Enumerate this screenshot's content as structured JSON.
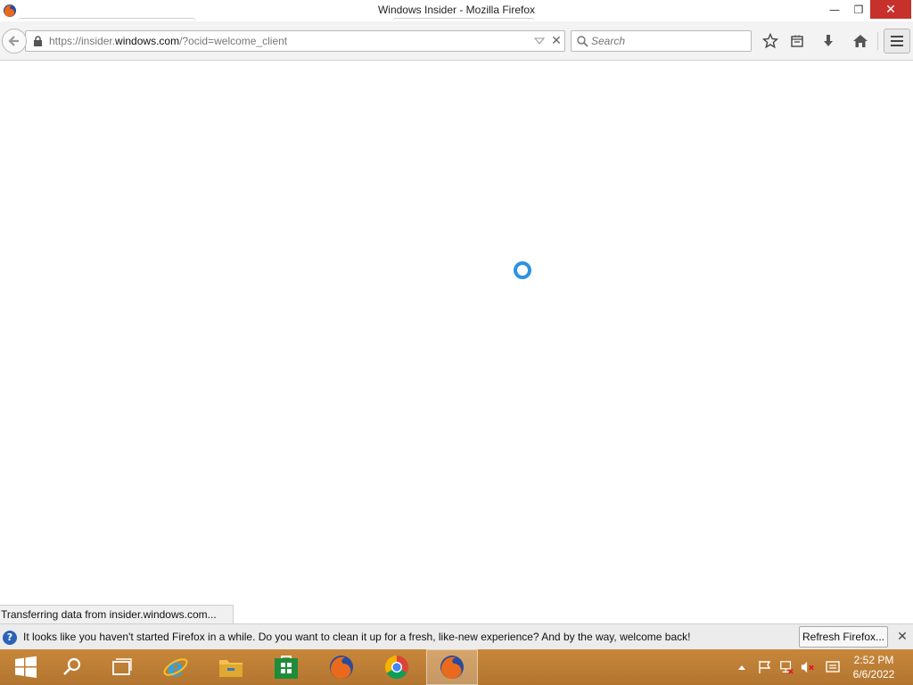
{
  "window": {
    "title": "Windows Insider - Mozilla Firefox",
    "minimize_glyph": "—",
    "restore_glyph": "❐",
    "close_glyph": "✕"
  },
  "navbar": {
    "url_prefix": "https://insider.",
    "url_host": "windows.com",
    "url_suffix": "/?ocid=welcome_client",
    "search_placeholder": "Search"
  },
  "status": {
    "text": "Transferring data from insider.windows.com..."
  },
  "notification": {
    "message": "It looks like you haven't started Firefox in a while. Do you want to clean it up for a fresh, like-new experience? And by the way, welcome back!",
    "button_label": "Refresh Firefox...",
    "info_glyph": "?",
    "close_glyph": "✕"
  },
  "taskbar": {
    "items": [
      "start-icon",
      "search-icon",
      "task-view-icon",
      "internet-explorer-icon",
      "file-explorer-icon",
      "store-icon",
      "firefox-icon",
      "chrome-icon",
      "firefox-icon"
    ],
    "clock_time": "2:52 PM",
    "clock_date": "6/6/2022",
    "color": "#c8873a"
  },
  "colors": {
    "accent": "#2f92e0",
    "close_button": "#c7312b"
  }
}
